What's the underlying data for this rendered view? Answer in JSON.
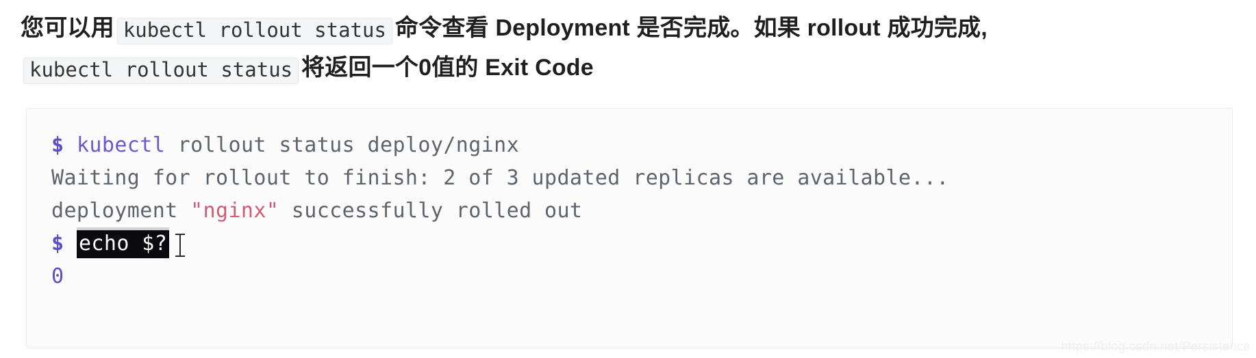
{
  "prose": {
    "part1": "您可以用",
    "inline_code_1": "kubectl rollout status",
    "part2": "命令查看 Deployment 是否完成。如果 rollout 成功完成,",
    "inline_code_2": "kubectl rollout status",
    "part3": "将返回一个0值的 Exit Code"
  },
  "code_block": {
    "lines": [
      {
        "id": "line-command",
        "tokens": [
          {
            "text": "$",
            "style": "prompt"
          },
          {
            "text": " ",
            "style": "plain"
          },
          {
            "text": "kubectl",
            "style": "cmd"
          },
          {
            "text": " rollout status deploy/nginx",
            "style": "plain"
          }
        ]
      },
      {
        "id": "line-waiting",
        "tokens": [
          {
            "text": "Waiting for rollout to finish: 2 of 3 updated replicas are available...",
            "style": "plain"
          }
        ]
      },
      {
        "id": "line-success",
        "tokens": [
          {
            "text": "deployment ",
            "style": "plain"
          },
          {
            "text": "\"nginx\"",
            "style": "string"
          },
          {
            "text": " successfully rolled out",
            "style": "plain"
          }
        ]
      },
      {
        "id": "line-echo",
        "tokens": [
          {
            "text": "$",
            "style": "prompt"
          },
          {
            "text": " ",
            "style": "plain"
          },
          {
            "text": "echo $?",
            "style": "selected"
          }
        ]
      },
      {
        "id": "line-exit-code",
        "tokens": [
          {
            "text": "0",
            "style": "num"
          }
        ]
      }
    ]
  },
  "cursor": {
    "type": "text-ibeam"
  },
  "watermark": {
    "text": "https://blog.csdn.net/Persistence"
  },
  "colors": {
    "page_background": "#ffffff",
    "text": "#1f1f1f",
    "inline_code_bg": "#f4f5f6",
    "inline_code_border": "#e6e8ea",
    "code_block_bg": "#fbfbfc",
    "code_block_border": "#e9eaec",
    "code_text": "#5d646c",
    "prompt": "#5b4fc7",
    "command": "#6a5acd",
    "string": "#d05c73",
    "selection_bg": "#0b0b0f",
    "selection_text": "#ffffff",
    "watermark": "#f0f0f0"
  }
}
